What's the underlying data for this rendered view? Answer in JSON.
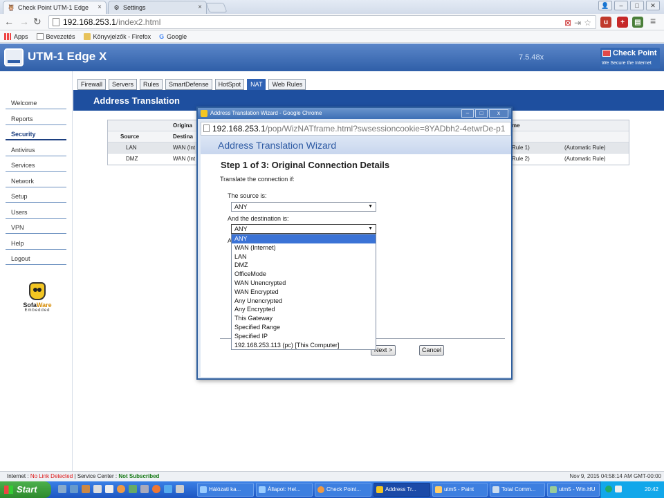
{
  "browser": {
    "tabs": [
      {
        "title": "Check Point UTM-1 Edge",
        "active": true
      },
      {
        "title": "Settings",
        "active": false
      }
    ],
    "url_host": "192.168.253.1",
    "url_path": "/index2.html",
    "bookmarks": [
      "Apps",
      "Bevezetés",
      "Könyvjelzők - Firefox",
      "Google"
    ]
  },
  "app": {
    "title": "UTM-1 Edge X",
    "version": "7.5.48x",
    "brand": "Check Point",
    "brand_tagline": "We Secure the Internet"
  },
  "sidebar": {
    "items": [
      "Welcome",
      "Reports",
      "Security",
      "Antivirus",
      "Services",
      "Network",
      "Setup",
      "Users",
      "VPN",
      "Help",
      "Logout"
    ],
    "active": "Security",
    "logo_brand_a": "Sofa",
    "logo_brand_b": "Ware",
    "logo_sub": "Embedded"
  },
  "tabs": [
    "Firewall",
    "Servers",
    "Rules",
    "SmartDefense",
    "HotSpot",
    "NAT",
    "Web Rules"
  ],
  "active_tab": "NAT",
  "section_title": "Address Translation",
  "bg_table": {
    "header1": [
      "",
      "Origina",
      "me",
      ""
    ],
    "header2": [
      "Source",
      "Destina",
      "",
      ""
    ],
    "rows": [
      {
        "source": "LAN",
        "dest": "WAN (Int",
        "rule": "Rule 1)",
        "note": "(Automatic Rule)"
      },
      {
        "source": "DMZ",
        "dest": "WAN (Int",
        "rule": "Rule 2)",
        "note": "(Automatic Rule)"
      }
    ]
  },
  "dialog": {
    "window_title": "Address Translation Wizard - Google Chrome",
    "url_host": "192.168.253.1",
    "url_path": "/pop/WizNATframe.html?swsessioncookie=8YADbh2-4etwrDe-p1",
    "wizard_title": "Address Translation Wizard",
    "step_title": "Step 1 of 3: Original Connection Details",
    "intro": "Translate the connection if:",
    "source_label": "The source is:",
    "source_value": "ANY",
    "dest_label": "And the destination is:",
    "dest_value": "ANY",
    "partial_label": "A",
    "options": [
      "ANY",
      "WAN (Internet)",
      "LAN",
      "DMZ",
      "OfficeMode",
      "WAN Unencrypted",
      "WAN Encrypted",
      "Any Unencrypted",
      "Any Encrypted",
      "This Gateway",
      "Specified Range",
      "Specified IP",
      "192.168.253.113 (pc) [This Computer]"
    ],
    "highlighted_option": "ANY",
    "next_button": "Next >",
    "cancel_button": "Cancel"
  },
  "status": {
    "internet_label": "Internet :",
    "internet_value": "No Link Detected",
    "service_label": "Service Center :",
    "service_value": "Not Subscribed",
    "datetime": "Nov 9, 2015 04:58:14 AM GMT-00:00"
  },
  "taskbar": {
    "start": "Start",
    "tasks": [
      "Hálózati ka...",
      "Állapot: Hel...",
      "Check Point...",
      "Address Tr...",
      "utm5 - Paint",
      "Total Comm...",
      "utm5 - Win..."
    ],
    "active_task": "Address Tr...",
    "lang": "HU",
    "clock": "20:42"
  },
  "colors": {
    "header_blue": "#2f5fa8",
    "section_blue": "#1e4f9f",
    "highlight": "#3b73d6",
    "status_red": "#dd1111",
    "status_green": "#177a17"
  }
}
